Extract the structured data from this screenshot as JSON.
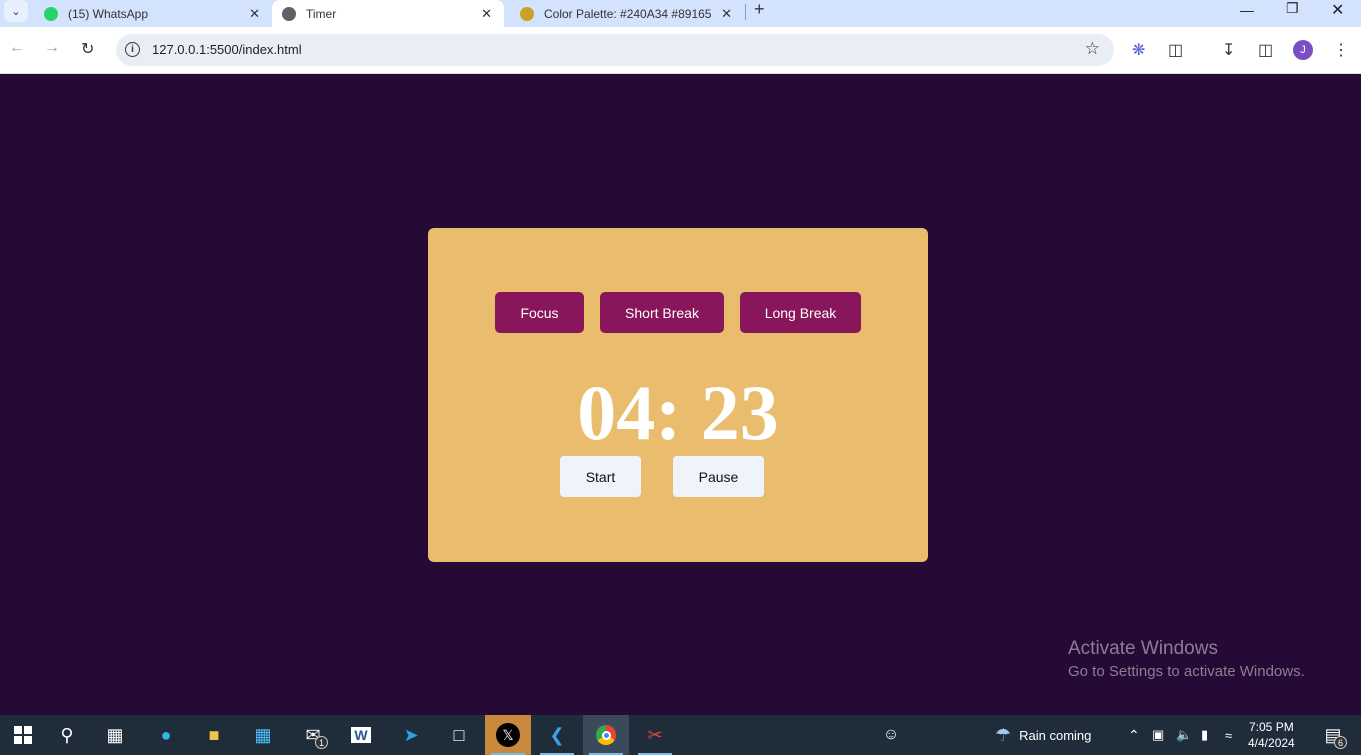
{
  "browser": {
    "tabs": [
      {
        "title": "(15) WhatsApp",
        "icon": "whatsapp-icon",
        "color": "#25D366"
      },
      {
        "title": "Timer",
        "icon": "globe-icon",
        "color": "#5f6368"
      },
      {
        "title": "Color Palette: #240A34 #89165",
        "icon": "palette-icon",
        "color": "#c9a227"
      }
    ],
    "url": "127.0.0.1:5500/index.html",
    "profile_initial": "J"
  },
  "timer": {
    "modes": [
      "Focus",
      "Short Break",
      "Long Break"
    ],
    "display": "04: 23",
    "start_label": "Start",
    "pause_label": "Pause"
  },
  "colors": {
    "background": "#240A34",
    "card": "#E9BC6E",
    "mode_button": "#89165A",
    "control_button": "#EEF4FA"
  },
  "watermark": {
    "title": "Activate Windows",
    "subtitle": "Go to Settings to activate Windows."
  },
  "taskbar": {
    "mail_badge": "1",
    "weather": "Rain coming",
    "time": "7:05 PM",
    "date": "4/4/2024",
    "notification_count": "6"
  }
}
